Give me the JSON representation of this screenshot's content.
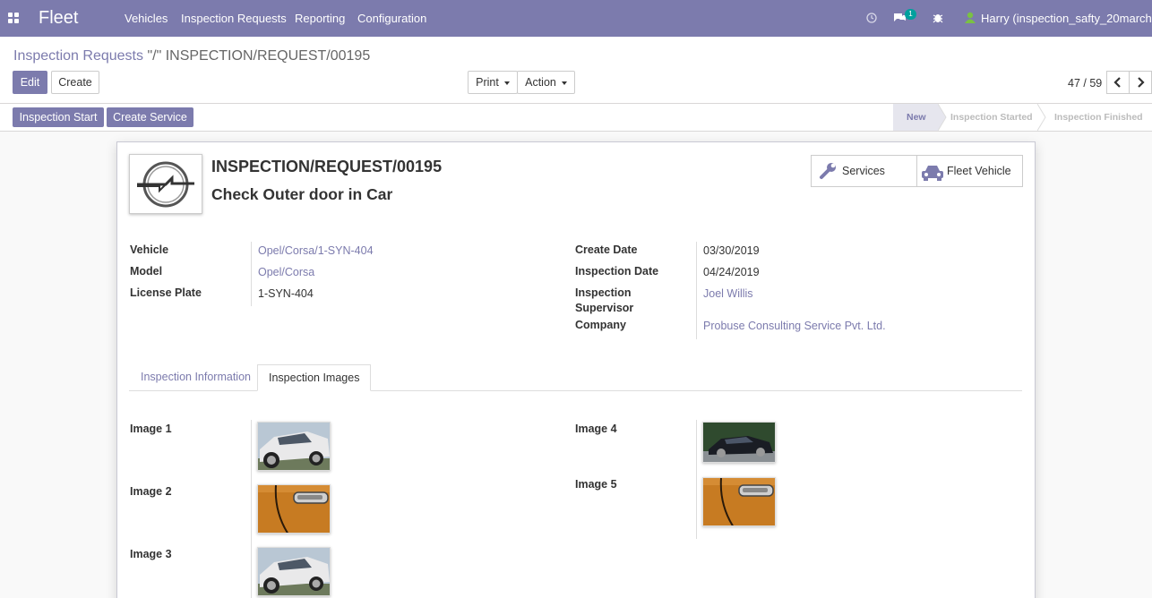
{
  "navbar": {
    "brand": "Fleet",
    "menu": [
      "Vehicles",
      "Inspection Requests",
      "Reporting",
      "Configuration"
    ],
    "message_count": "1",
    "user": "Harry (inspection_safty_20march)"
  },
  "breadcrumb": {
    "parent": "Inspection Requests",
    "separator": "\"/\"",
    "current": "INSPECTION/REQUEST/00195"
  },
  "buttons": {
    "edit": "Edit",
    "create": "Create",
    "print": "Print",
    "action": "Action",
    "inspection_start": "Inspection Start",
    "create_service": "Create Service"
  },
  "pager": {
    "value": "47 / 59"
  },
  "stages": [
    "New",
    "Inspection Started",
    "Inspection Finished"
  ],
  "record": {
    "name": "INSPECTION/REQUEST/00195",
    "subject": "Check Outer door in Car"
  },
  "smart_buttons": {
    "services": "Services",
    "fleet_vehicle": "Fleet Vehicle"
  },
  "fields": {
    "vehicle": {
      "label": "Vehicle",
      "value": "Opel/Corsa/1-SYN-404"
    },
    "model": {
      "label": "Model",
      "value": "Opel/Corsa"
    },
    "license_plate": {
      "label": "License Plate",
      "value": "1-SYN-404"
    },
    "create_date": {
      "label": "Create Date",
      "value": "03/30/2019"
    },
    "inspection_date": {
      "label": "Inspection Date",
      "value": "04/24/2019"
    },
    "supervisor": {
      "label_line1": "Inspection",
      "label_line2": "Supervisor",
      "value": "Joel Willis"
    },
    "company": {
      "label": "Company",
      "value": "Probuse Consulting Service Pvt. Ltd."
    }
  },
  "tabs": [
    "Inspection Information",
    "Inspection Images"
  ],
  "images": [
    {
      "label": "Image 1"
    },
    {
      "label": "Image 2"
    },
    {
      "label": "Image 3"
    },
    {
      "label": "Image 4"
    },
    {
      "label": "Image 5"
    }
  ],
  "colors": {
    "brand": "#7c7bad",
    "link": "#7c7bad"
  }
}
